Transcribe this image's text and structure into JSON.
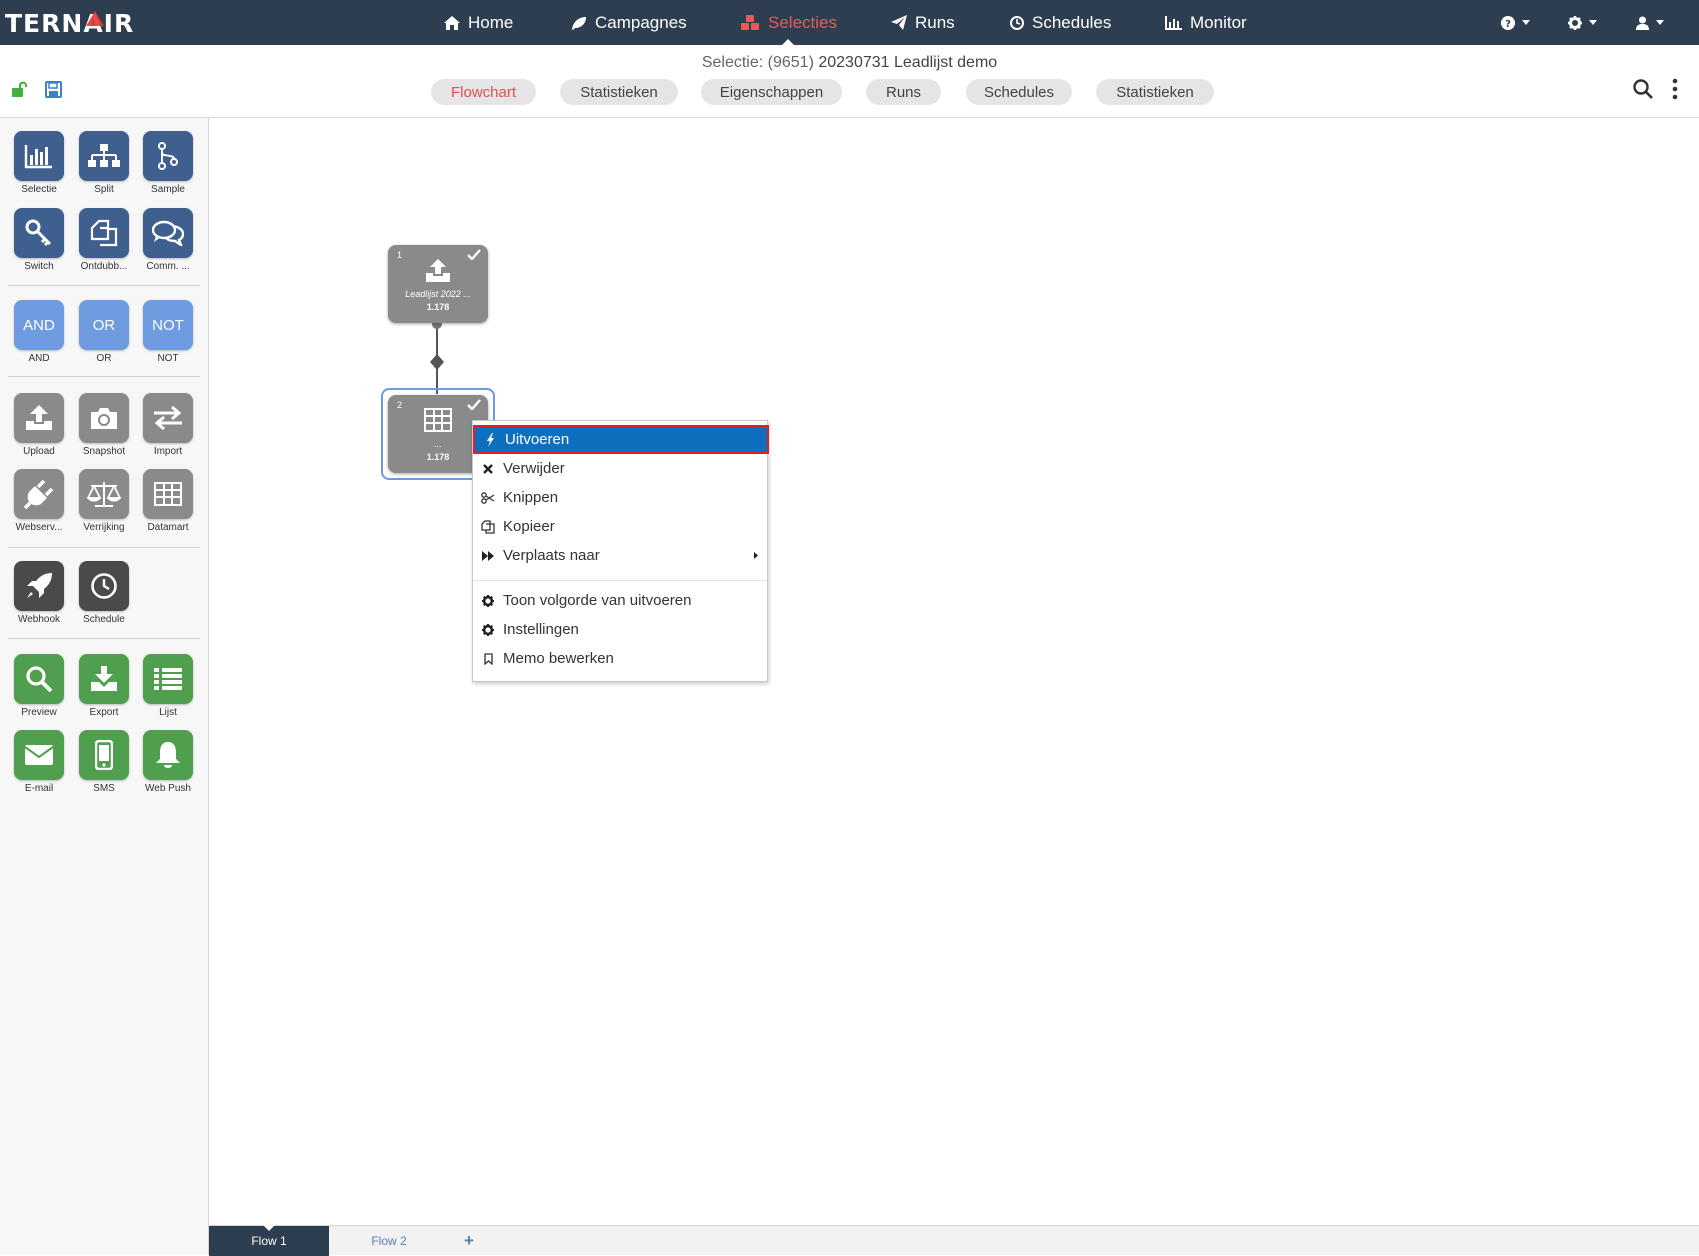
{
  "app": {
    "logo": "TERNAIR"
  },
  "nav": [
    {
      "label": "Home",
      "icon": "home-icon"
    },
    {
      "label": "Campagnes",
      "icon": "leaf-icon"
    },
    {
      "label": "Selecties",
      "icon": "cubes-icon",
      "active": true
    },
    {
      "label": "Runs",
      "icon": "paper-plane-icon"
    },
    {
      "label": "Schedules",
      "icon": "clock-icon"
    },
    {
      "label": "Monitor",
      "icon": "bar-chart-icon"
    }
  ],
  "header": {
    "title_prefix": "Selectie:",
    "title_id": "(9651)",
    "title_name": "20230731 Leadlijst demo"
  },
  "tabs": [
    "Flowchart",
    "Statistieken",
    "Eigenschappen",
    "Runs",
    "Schedules",
    "Statistieken"
  ],
  "active_tab": "Flowchart",
  "palette": {
    "row1": [
      "Selectie",
      "Split",
      "Sample"
    ],
    "row2": [
      "Switch",
      "Ontdubb...",
      "Comm. ..."
    ],
    "logic": [
      {
        "text": "AND",
        "label": "AND"
      },
      {
        "text": "OR",
        "label": "OR"
      },
      {
        "text": "NOT",
        "label": "NOT"
      }
    ],
    "row4": [
      "Upload",
      "Snapshot",
      "Import"
    ],
    "row5": [
      "Webserv...",
      "Verrijking",
      "Datamart"
    ],
    "row6": [
      "Webhook",
      "Schedule"
    ],
    "row7": [
      "Preview",
      "Export",
      "Lijst"
    ],
    "row8": [
      "E-mail",
      "SMS",
      "Web Push"
    ]
  },
  "nodes": [
    {
      "number": "1",
      "name": "Leadlijst 2022 ...",
      "count": "1.178",
      "icon": "upload-icon",
      "status": "checkmark-icon"
    },
    {
      "number": "2",
      "name": "...",
      "count": "1.178",
      "icon": "table-grid-icon",
      "status": "checkmark-icon"
    }
  ],
  "context_menu": {
    "items": [
      {
        "label": "Uitvoeren",
        "icon": "bolt-icon",
        "highlighted": true
      },
      {
        "label": "Verwijder",
        "icon": "close-icon"
      },
      {
        "label": "Knippen",
        "icon": "scissors-icon"
      },
      {
        "label": "Kopieer",
        "icon": "copy-icon"
      },
      {
        "label": "Verplaats naar",
        "icon": "forward-icon",
        "submenu": true
      },
      {
        "label": "Toon volgorde van uitvoeren",
        "icon": "gear-icon"
      },
      {
        "label": "Instellingen",
        "icon": "gear-icon"
      },
      {
        "label": "Memo bewerken",
        "icon": "bookmark-icon"
      }
    ]
  },
  "bottom_tabs": [
    {
      "label": "Flow 1",
      "active": true
    },
    {
      "label": "Flow 2",
      "active": false
    },
    {
      "label": "+",
      "active": false
    }
  ]
}
